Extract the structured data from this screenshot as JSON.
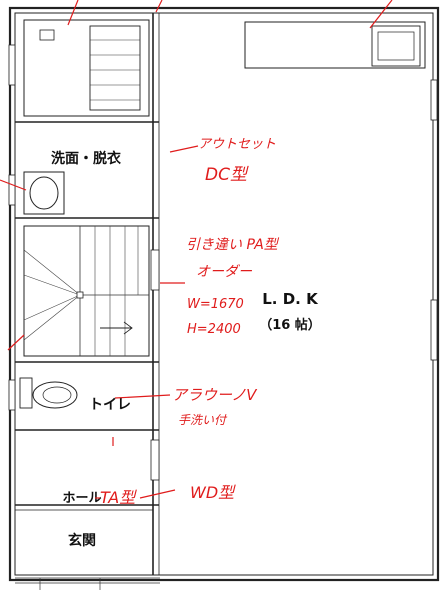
{
  "rooms": {
    "senmen": "洗面・脱衣",
    "ldk_name": "L. D. K",
    "ldk_size": "（16 帖）",
    "toilet": "トイレ",
    "hall": "ホール",
    "genkan": "玄関"
  },
  "notes": {
    "outlet": "アウトセット",
    "dc": "DC型",
    "hikichigai": "引き違い PA型",
    "order": "オーダー",
    "width": "W=1670",
    "height": "H=2400",
    "aragu": "アラウーノV",
    "tearai": "手洗い付",
    "ta": "TA型",
    "wd": "WD型"
  },
  "colors": {
    "annotation": "#e01c1c",
    "line": "#222222"
  }
}
